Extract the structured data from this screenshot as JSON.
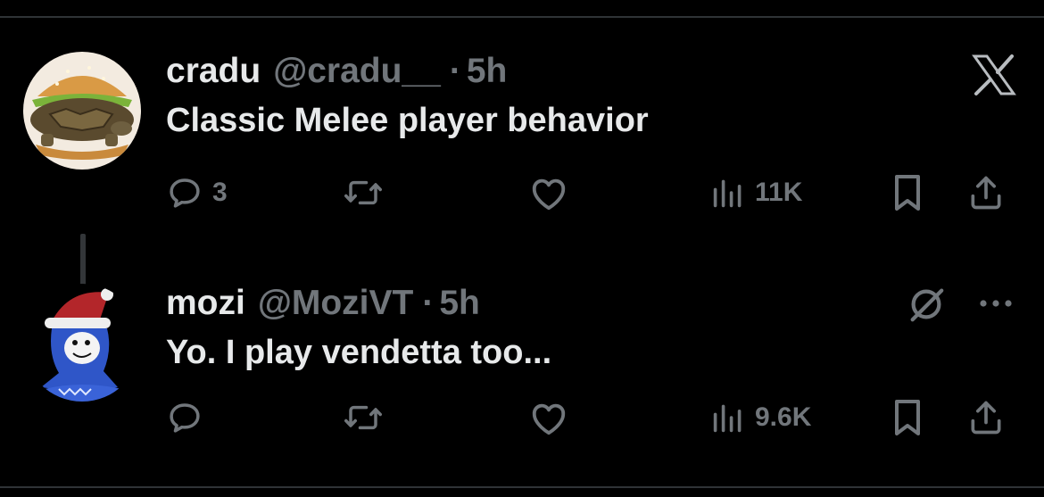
{
  "tweets": [
    {
      "name": "cradu",
      "handle": "@cradu__",
      "separator": "·",
      "time": "5h",
      "text": "Classic Melee player behavior",
      "reply_count": "3",
      "repost_count": "",
      "like_count": "",
      "views": "11K",
      "avatar": "turtle-burger-avatar"
    },
    {
      "name": "mozi",
      "handle": "@MoziVT",
      "separator": "·",
      "time": "5h",
      "text": "Yo. I play vendetta too...",
      "reply_count": "",
      "repost_count": "",
      "like_count": "",
      "views": "9.6K",
      "avatar": "blue-character-santa-hat-avatar"
    }
  ],
  "icons": {
    "close": "x-logo-icon",
    "reply": "reply-icon",
    "repost": "repost-icon",
    "like": "heart-icon",
    "views": "views-icon",
    "bookmark": "bookmark-icon",
    "share": "share-icon",
    "grok": "grok-icon",
    "more": "more-icon"
  },
  "colors": {
    "background": "#000000",
    "text_primary": "#e7e9ea",
    "text_secondary": "#71767b",
    "divider": "#2f3336"
  }
}
